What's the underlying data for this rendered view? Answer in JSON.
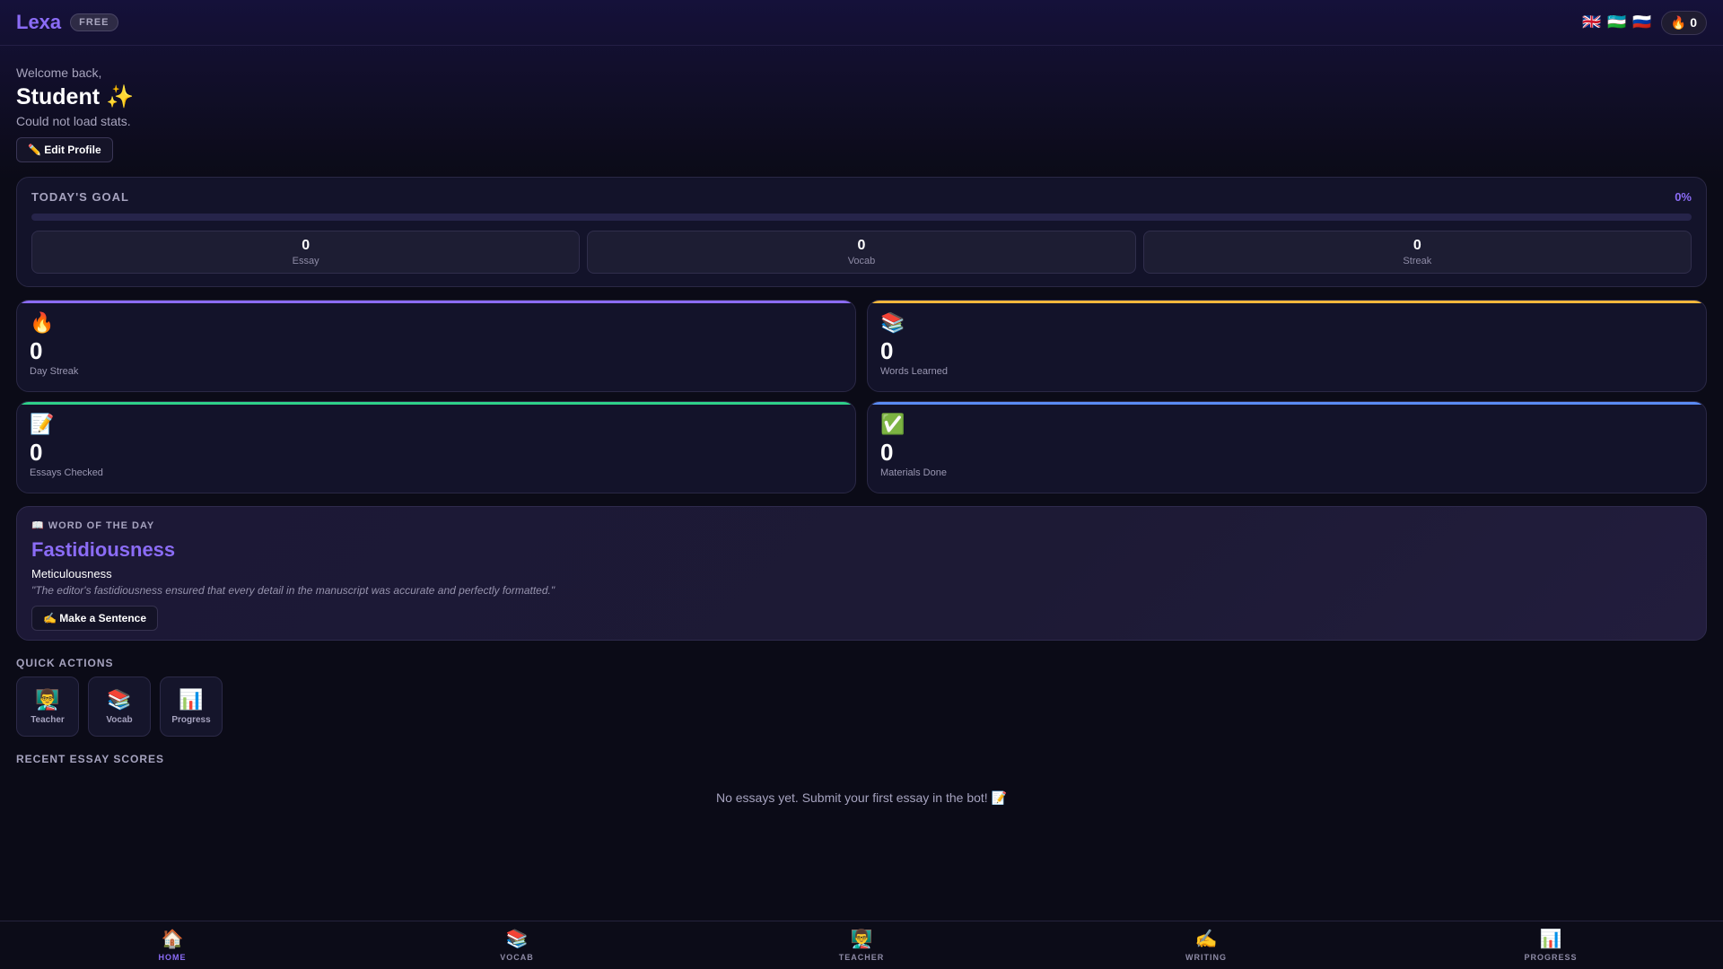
{
  "header": {
    "logo": "Lexa",
    "plan_badge": "FREE",
    "flags": [
      {
        "icon": "🇬🇧",
        "name": "english-flag-icon"
      },
      {
        "icon": "🇺🇿",
        "name": "uzbek-flag-icon"
      },
      {
        "icon": "🇷🇺",
        "name": "russian-flag-icon"
      }
    ],
    "streak_icon": "🔥",
    "streak_count": "0"
  },
  "greeting": {
    "welcome": "Welcome back,",
    "name": "Student ✨",
    "status": "Could not load stats.",
    "edit_button": "✏️ Edit Profile"
  },
  "goal": {
    "title": "TODAY'S GOAL",
    "percent": "0%",
    "progress": 0,
    "accent": "#8b6cf6",
    "stats": [
      {
        "value": "0",
        "label": "Essay"
      },
      {
        "value": "0",
        "label": "Vocab"
      },
      {
        "value": "0",
        "label": "Streak"
      }
    ]
  },
  "stats": [
    {
      "icon": "🔥",
      "value": "0",
      "label": "Day Streak",
      "accent": "#8b6cf6"
    },
    {
      "icon": "📚",
      "value": "0",
      "label": "Words Learned",
      "accent": "#f4b73c"
    },
    {
      "icon": "📝",
      "value": "0",
      "label": "Essays Checked",
      "accent": "#2fd18a"
    },
    {
      "icon": "✅",
      "value": "0",
      "label": "Materials Done",
      "accent": "#5b8cf5"
    }
  ],
  "word_of_day": {
    "heading": "📖 WORD OF THE DAY",
    "word": "Fastidiousness",
    "definition": "Meticulousness",
    "example": "\"The editor's fastidiousness ensured that every detail in the manuscript was accurate and perfectly formatted.\"",
    "button": "✍️ Make a Sentence"
  },
  "quick_actions": {
    "title": "QUICK ACTIONS",
    "items": [
      {
        "icon": "👨‍🏫",
        "label": "Teacher"
      },
      {
        "icon": "📚",
        "label": "Vocab"
      },
      {
        "icon": "📊",
        "label": "Progress"
      }
    ]
  },
  "recent": {
    "title": "RECENT ESSAY SCORES",
    "empty": "No essays yet. Submit your first essay in the bot! 📝"
  },
  "nav": [
    {
      "icon": "🏠",
      "label": "HOME",
      "active": true
    },
    {
      "icon": "📚",
      "label": "VOCAB"
    },
    {
      "icon": "👨‍🏫",
      "label": "TEACHER"
    },
    {
      "icon": "✍️",
      "label": "WRITING"
    },
    {
      "icon": "📊",
      "label": "PROGRESS"
    }
  ]
}
